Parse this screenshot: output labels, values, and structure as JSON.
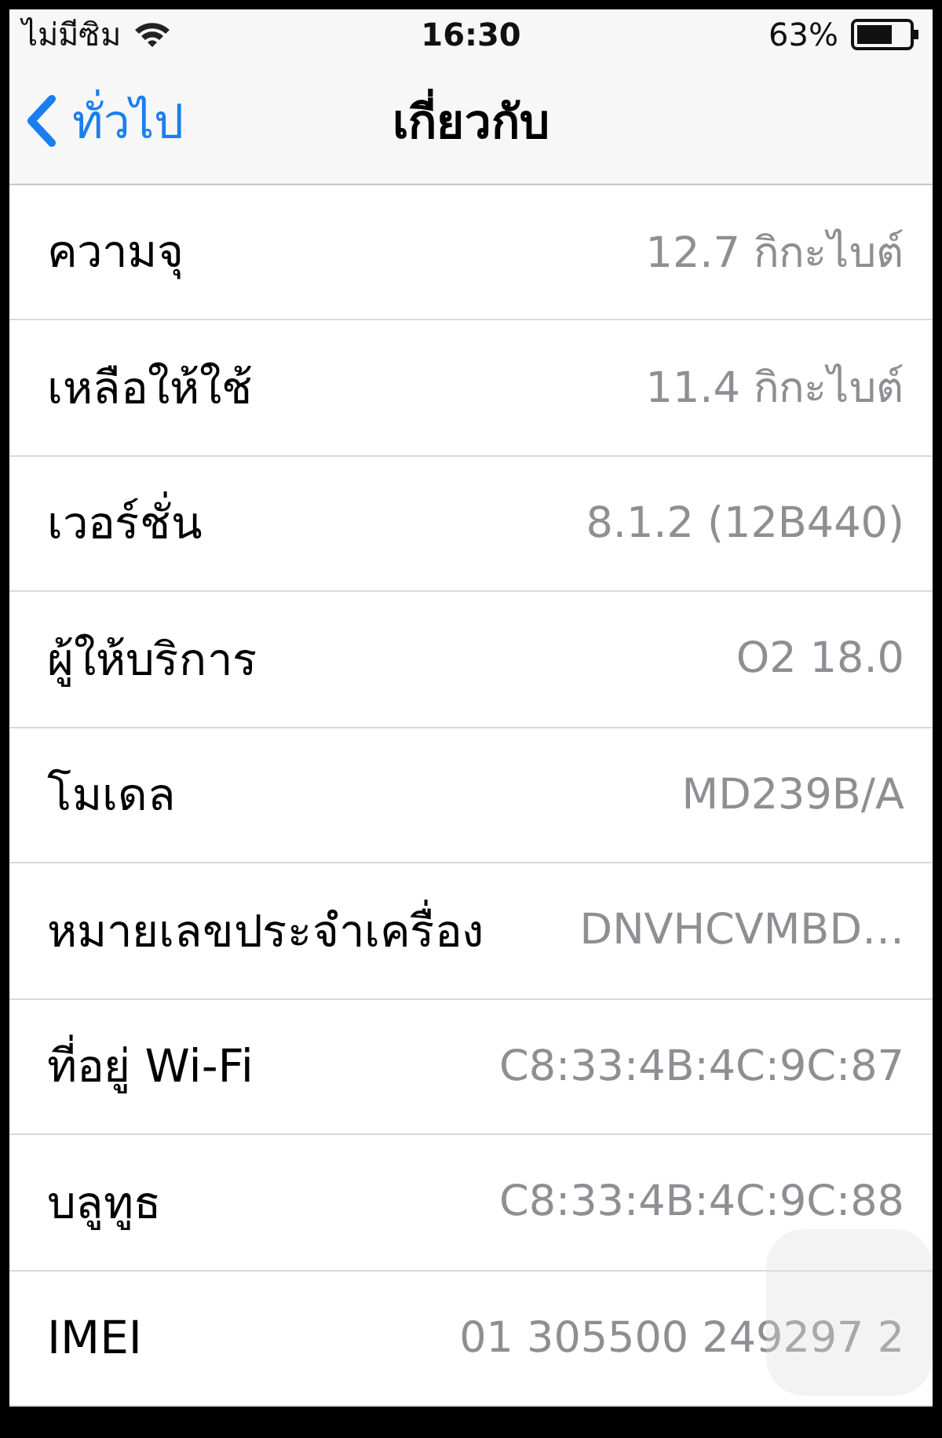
{
  "status_bar": {
    "carrier": "ไม่มีซิม",
    "time": "16:30",
    "battery": "63%"
  },
  "nav_bar": {
    "back": "ทั่วไป",
    "title": "เกี่ยวกับ"
  },
  "rows": [
    {
      "label": "ความจุ",
      "value": "12.7 กิกะไบต์"
    },
    {
      "label": "เหลือให้ใช้",
      "value": "11.4 กิกะไบต์"
    },
    {
      "label": "เวอร์ชั่น",
      "value": "8.1.2 (12B440)"
    },
    {
      "label": "ผู้ให้บริการ",
      "value": "O2 18.0"
    },
    {
      "label": "โมเดล",
      "value": "MD239B/A"
    },
    {
      "label": "หมายเลขประจำเครื่อง",
      "value": "DNVHCVMBD…"
    },
    {
      "label": "ที่อยู่ Wi-Fi",
      "value": "C8:33:4B:4C:9C:87"
    },
    {
      "label": "บลูทูธ",
      "value": "C8:33:4B:4C:9C:88"
    },
    {
      "label": "IMEI",
      "value": "01 305500 249297 2"
    }
  ]
}
